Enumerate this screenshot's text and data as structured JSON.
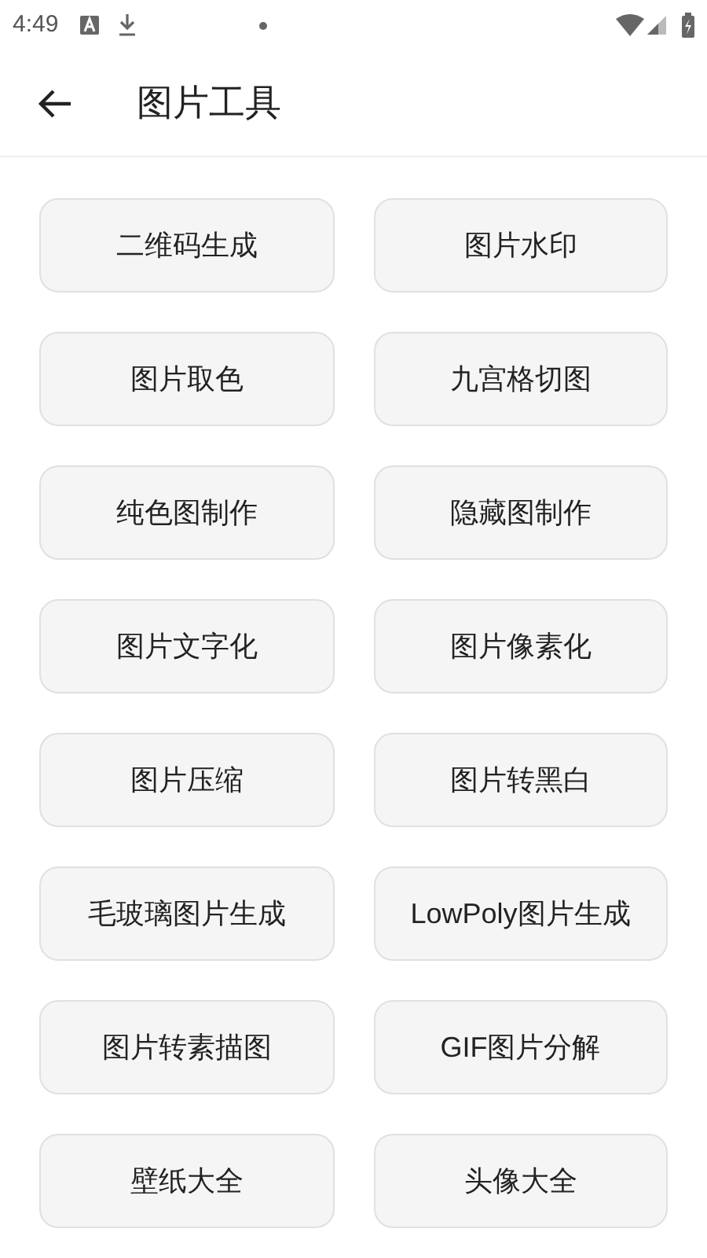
{
  "status_bar": {
    "time": "4:49"
  },
  "app_bar": {
    "title": "图片工具"
  },
  "tools": [
    {
      "label": "二维码生成"
    },
    {
      "label": "图片水印"
    },
    {
      "label": "图片取色"
    },
    {
      "label": "九宫格切图"
    },
    {
      "label": "纯色图制作"
    },
    {
      "label": "隐藏图制作"
    },
    {
      "label": "图片文字化"
    },
    {
      "label": "图片像素化"
    },
    {
      "label": "图片压缩"
    },
    {
      "label": "图片转黑白"
    },
    {
      "label": "毛玻璃图片生成"
    },
    {
      "label": "LowPoly图片生成"
    },
    {
      "label": "图片转素描图"
    },
    {
      "label": "GIF图片分解"
    },
    {
      "label": "壁纸大全"
    },
    {
      "label": "头像大全"
    }
  ]
}
